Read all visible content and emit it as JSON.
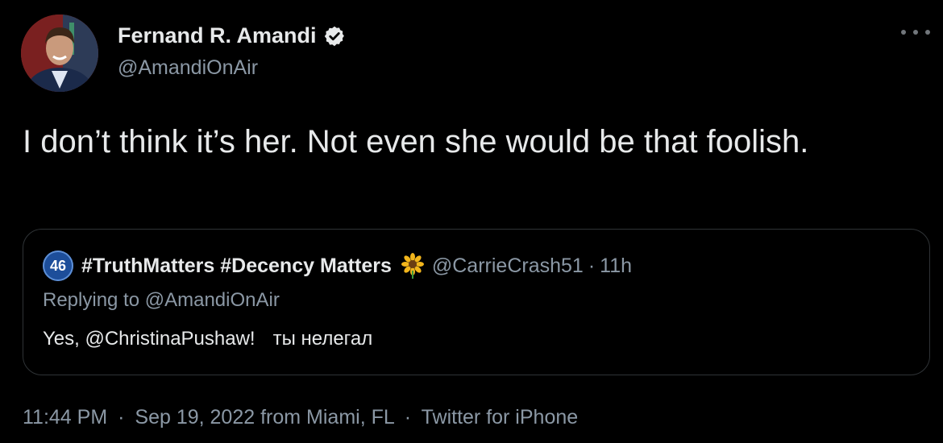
{
  "author": {
    "display_name": "Fernand R. Amandi",
    "handle": "@AmandiOnAir",
    "verified": true
  },
  "tweet": {
    "text": "I don’t think it’s her. Not even she would be that foolish."
  },
  "quoted": {
    "avatar_text": "46",
    "display_name": "#TruthMatters #Decency Matters",
    "emoji": "sunflower-icon",
    "handle": "@CarrieCrash51",
    "separator": "·",
    "time": "11h",
    "replying_to": "Replying to @AmandiOnAir",
    "text_main": "Yes, @ChristinaPushaw!",
    "text_extra": "ты нелегал"
  },
  "meta": {
    "time": "11:44 PM",
    "sep1": "·",
    "date": "Sep 19, 2022",
    "location": "from Miami, FL",
    "sep2": "·",
    "source": "Twitter for iPhone"
  },
  "colors": {
    "background": "#000000",
    "primary_text": "#e7e9ea",
    "secondary_text": "#8b98a5",
    "border": "#2f3336",
    "verified_badge": "#e7e9ea"
  }
}
